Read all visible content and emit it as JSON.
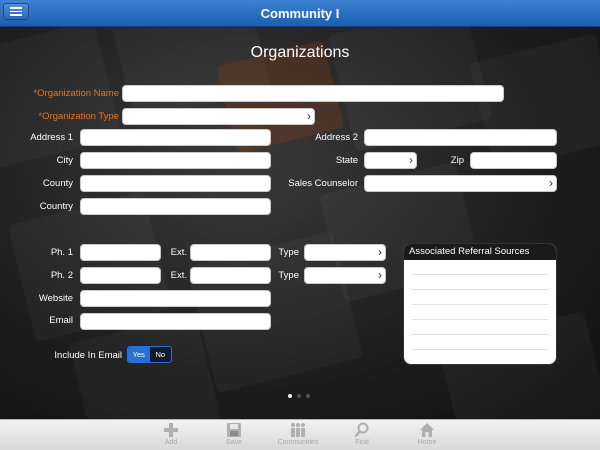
{
  "header": {
    "title": "Community I"
  },
  "page": {
    "title": "Organizations"
  },
  "fields": {
    "org_name": {
      "label": "*Organization Name",
      "value": ""
    },
    "org_type": {
      "label": "*Organization Type",
      "value": ""
    },
    "address1": {
      "label": "Address 1",
      "value": ""
    },
    "address2": {
      "label": "Address 2",
      "value": ""
    },
    "city": {
      "label": "City",
      "value": ""
    },
    "state": {
      "label": "State",
      "value": ""
    },
    "zip": {
      "label": "Zip",
      "value": ""
    },
    "county": {
      "label": "County",
      "value": ""
    },
    "sales_counselor": {
      "label": "Sales Counselor",
      "value": ""
    },
    "country": {
      "label": "Country",
      "value": ""
    },
    "ph1": {
      "label": "Ph. 1",
      "value": ""
    },
    "ph1_ext": {
      "label": "Ext.",
      "value": ""
    },
    "ph1_type": {
      "label": "Type",
      "value": ""
    },
    "ph2": {
      "label": "Ph. 2",
      "value": ""
    },
    "ph2_ext": {
      "label": "Ext.",
      "value": ""
    },
    "ph2_type": {
      "label": "Type",
      "value": ""
    },
    "website": {
      "label": "Website",
      "value": ""
    },
    "email": {
      "label": "Email",
      "value": ""
    }
  },
  "include_in_email": {
    "label": "Include In Email",
    "yes": "Yes",
    "no": "No",
    "selected": "Yes"
  },
  "referral_panel": {
    "title": "Associated Referral Sources",
    "items": []
  },
  "pager": {
    "count": 3,
    "active": 1
  },
  "tabbar": [
    {
      "label": "Add",
      "icon": "plus-icon"
    },
    {
      "label": "Save",
      "icon": "floppy-disk-icon"
    },
    {
      "label": "Communities",
      "icon": "people-icon"
    },
    {
      "label": "Find",
      "icon": "magnifier-icon"
    },
    {
      "label": "Home",
      "icon": "house-icon"
    }
  ],
  "colors": {
    "header": "#2a6fc4",
    "required_label": "#e8731f",
    "toggle_on": "#2a6fd6"
  }
}
